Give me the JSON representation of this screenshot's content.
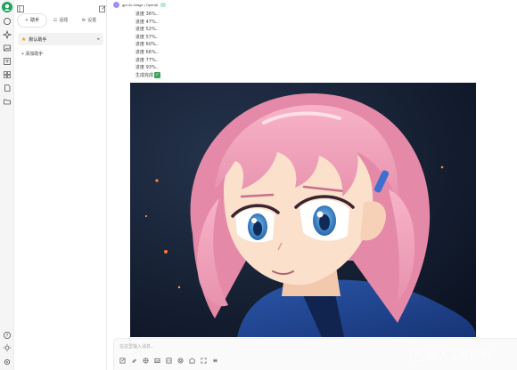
{
  "rail": {
    "logo": "brand-logo",
    "icons": [
      "chat-icon",
      "sparkle-icon",
      "image-icon",
      "translate-icon",
      "apps-icon",
      "document-icon",
      "folder-icon"
    ],
    "bottom_icons": [
      "help-icon",
      "theme-icon",
      "settings-icon"
    ]
  },
  "sidebar": {
    "tabs": [
      {
        "icon": "✧",
        "label": "助手"
      },
      {
        "icon": "☷",
        "label": "话题"
      },
      {
        "icon": "⚙",
        "label": "设置"
      }
    ],
    "assistant": {
      "label": "默认助手"
    },
    "add_assistant": "+ 添加助手"
  },
  "header": {
    "model_name": "gpt-4o-image | OpenAI"
  },
  "message": {
    "progress": [
      "进度 36%..",
      "进度 47%..",
      "进度 52%..",
      "进度 57%..",
      "进度 60%..",
      "进度 66%..",
      "进度 77%..",
      "进度 93%.."
    ],
    "done": "生成完成",
    "image_alt": "anime girl with pink hair and blue eyes"
  },
  "composer": {
    "placeholder": "在这里输入消息...",
    "tools": [
      "attach-icon",
      "paperclip-icon",
      "globe-icon",
      "image-gen-icon",
      "code-icon",
      "at-icon",
      "knowledge-icon",
      "expand-icon",
      "more-icon"
    ]
  },
  "watermark": {
    "logo_text": "AI",
    "text": "@人工智能吧"
  },
  "colors": {
    "brand": "#1fa35c",
    "done": "#3ba55d",
    "accent": "#a78bfa"
  }
}
